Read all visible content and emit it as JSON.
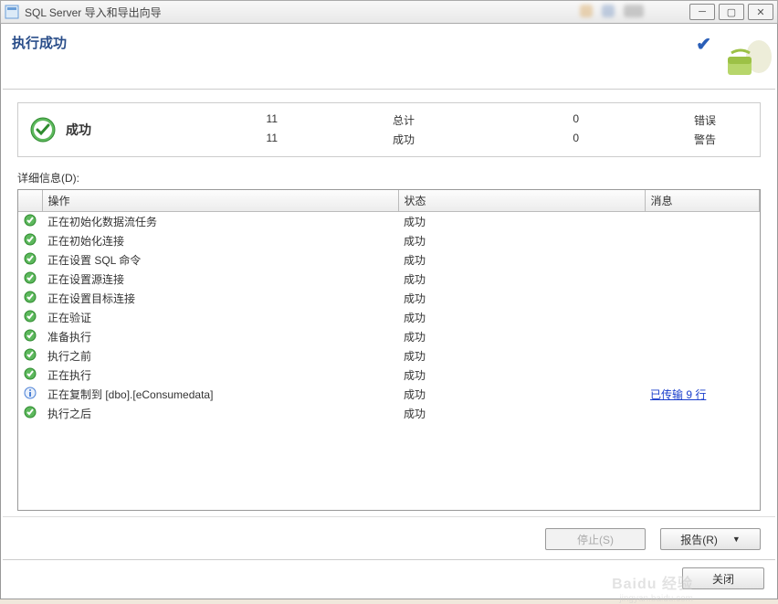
{
  "titlebar": {
    "title": "SQL Server 导入和导出向导"
  },
  "header": {
    "title": "执行成功"
  },
  "summary": {
    "label": "成功",
    "total_num": "11",
    "total_label": "总计",
    "error_num": "0",
    "error_label": "错误",
    "success_num": "11",
    "success_label": "成功",
    "warn_num": "0",
    "warn_label": "警告"
  },
  "details": {
    "label": "详细信息(D):"
  },
  "columns": {
    "op": "操作",
    "status": "状态",
    "msg": "消息"
  },
  "rows": [
    {
      "icon": "check",
      "op": "正在初始化数据流任务",
      "status": "成功",
      "msg": ""
    },
    {
      "icon": "check",
      "op": "正在初始化连接",
      "status": "成功",
      "msg": ""
    },
    {
      "icon": "check",
      "op": "正在设置 SQL 命令",
      "status": "成功",
      "msg": ""
    },
    {
      "icon": "check",
      "op": "正在设置源连接",
      "status": "成功",
      "msg": ""
    },
    {
      "icon": "check",
      "op": "正在设置目标连接",
      "status": "成功",
      "msg": ""
    },
    {
      "icon": "check",
      "op": "正在验证",
      "status": "成功",
      "msg": ""
    },
    {
      "icon": "check",
      "op": "准备执行",
      "status": "成功",
      "msg": ""
    },
    {
      "icon": "check",
      "op": "执行之前",
      "status": "成功",
      "msg": ""
    },
    {
      "icon": "check",
      "op": "正在执行",
      "status": "成功",
      "msg": ""
    },
    {
      "icon": "info",
      "op": "正在复制到 [dbo].[eConsumedata]",
      "status": "成功",
      "msg": "已传输 9 行"
    },
    {
      "icon": "check",
      "op": "执行之后",
      "status": "成功",
      "msg": ""
    }
  ],
  "buttons": {
    "stop": "停止(S)",
    "report": "报告(R)",
    "close": "关闭"
  },
  "watermark": {
    "main": "Baidu 经验",
    "sub": "jingyan.baidu.com"
  }
}
